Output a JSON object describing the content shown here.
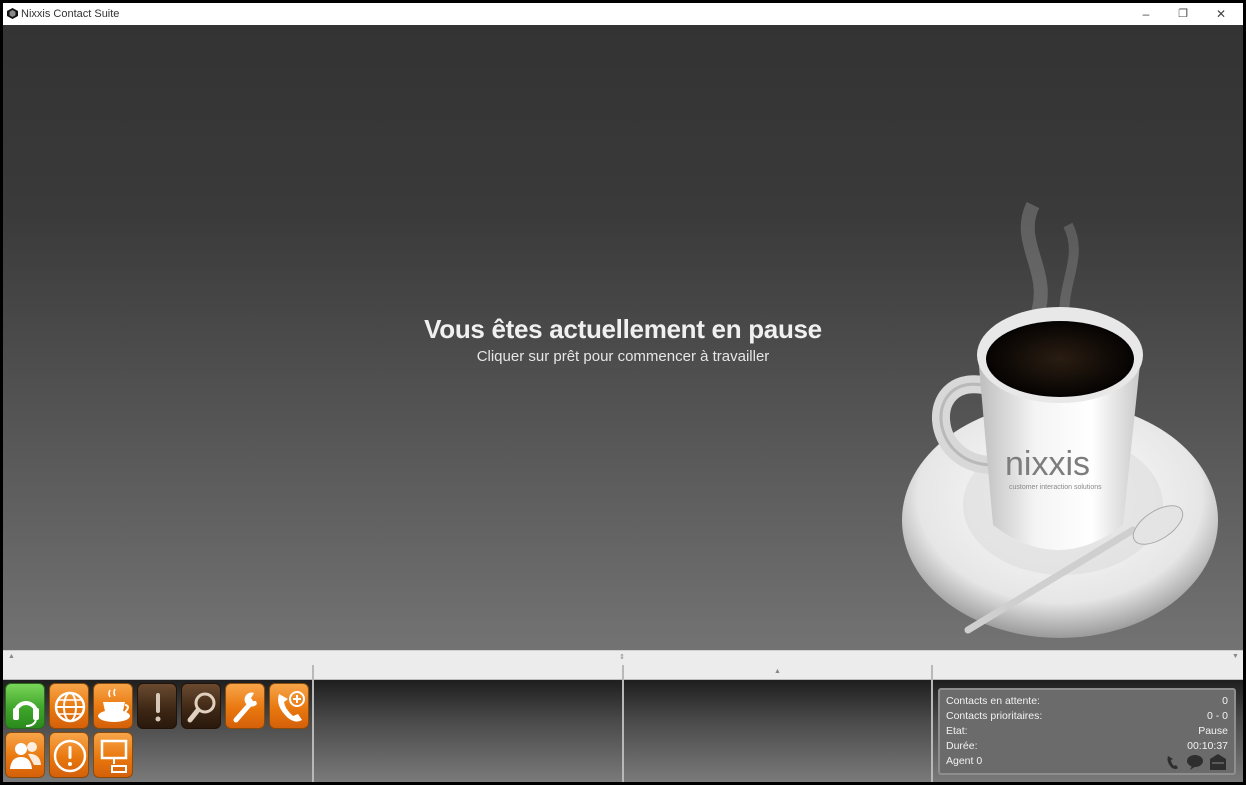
{
  "window": {
    "title": "Nixxis Contact Suite",
    "minimize": "–",
    "restore": "❐",
    "close": "✕"
  },
  "main": {
    "pause_title": "Vous êtes actuellement en pause",
    "pause_subtitle": "Cliquer sur prêt pour commencer à travailler",
    "logo_text": "nixxis",
    "logo_tagline": "customer interaction solutions"
  },
  "toolbar": {
    "row1": [
      "ready-headset",
      "web-globe",
      "pause-coffee",
      "alert",
      "search",
      "tools",
      "call-add"
    ],
    "row2": [
      "contacts",
      "warning",
      "screen"
    ]
  },
  "colors": {
    "orange": "#e9780e",
    "green": "#3fa52a",
    "brown": "#3c2614",
    "status_bg": "#6b6b6b"
  },
  "status": {
    "rows": [
      {
        "label": "Contacts en attente:",
        "value": "0"
      },
      {
        "label": "Contacts prioritaires:",
        "value": "0 - 0"
      },
      {
        "label": "Etat:",
        "value": "Pause"
      },
      {
        "label": "Durée:",
        "value": "00:10:37"
      },
      {
        "label": "Agent 0",
        "value": ""
      }
    ],
    "icons": [
      "phone-icon",
      "chat-icon",
      "mail-icon"
    ]
  }
}
